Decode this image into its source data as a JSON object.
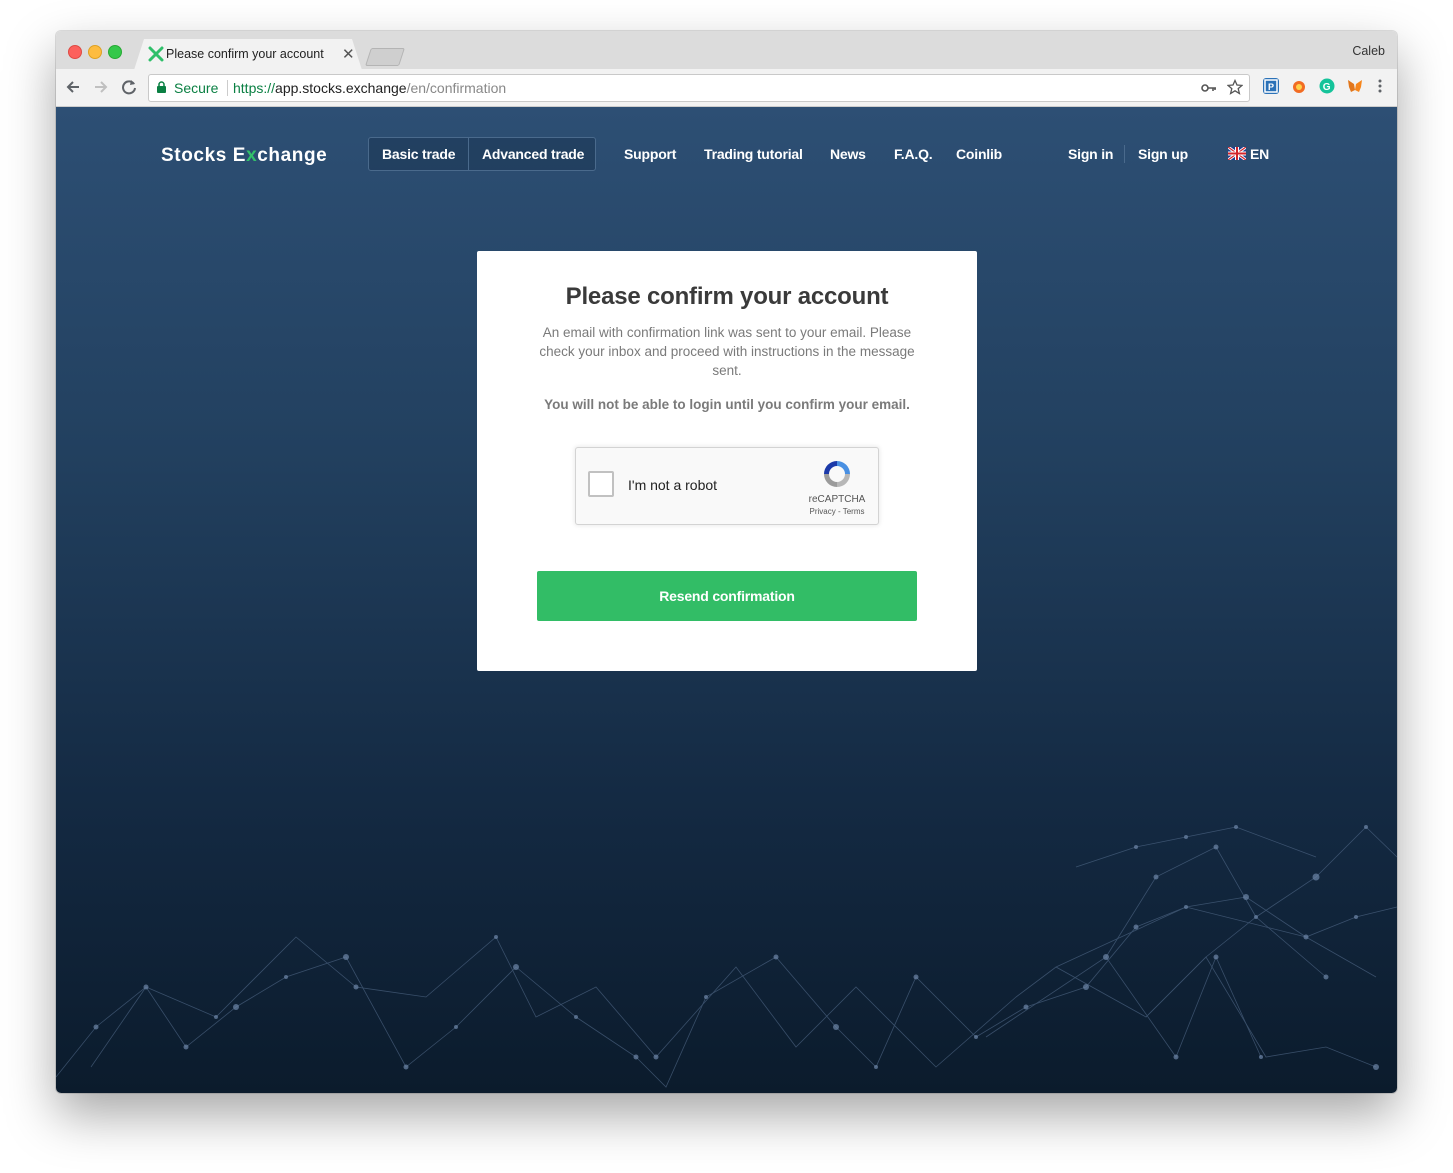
{
  "browser": {
    "tab_title": "Please confirm your account",
    "tab_close": "✕",
    "profile_name": "Caleb",
    "address": {
      "secure_label": "Secure",
      "scheme": "https://",
      "host": "app.stocks.exchange",
      "path": "/en/confirmation"
    },
    "icons": [
      "back-icon",
      "forward-icon",
      "reload-icon",
      "lock-icon",
      "key-icon",
      "bookmark-star-icon",
      "extension-icons",
      "menu-icon"
    ]
  },
  "site": {
    "logo": {
      "prefix": "Stocks E",
      "accent": "x",
      "suffix": "change"
    },
    "trade_tabs": [
      "Basic trade",
      "Advanced trade"
    ],
    "nav": {
      "support": "Support",
      "tutorial": "Trading tutorial",
      "news": "News",
      "faq": "F.A.Q.",
      "coinlib": "Coinlib"
    },
    "auth": {
      "sign_in": "Sign in",
      "sign_up": "Sign up"
    },
    "language": "EN"
  },
  "card": {
    "title": "Please confirm your account",
    "message": "An email with confirmation link was sent to your email. Please check your inbox and proceed with instructions in the message sent.",
    "warning": "You will not be able to login until you confirm your email.",
    "captcha": {
      "label": "I'm not a robot",
      "brand": "reCAPTCHA",
      "links": "Privacy - Terms"
    },
    "resend_button": "Resend confirmation"
  },
  "colors": {
    "accent_green": "#32bd66",
    "page_bg_top": "#2d4f74",
    "page_bg_bottom": "#0b1b2c"
  }
}
